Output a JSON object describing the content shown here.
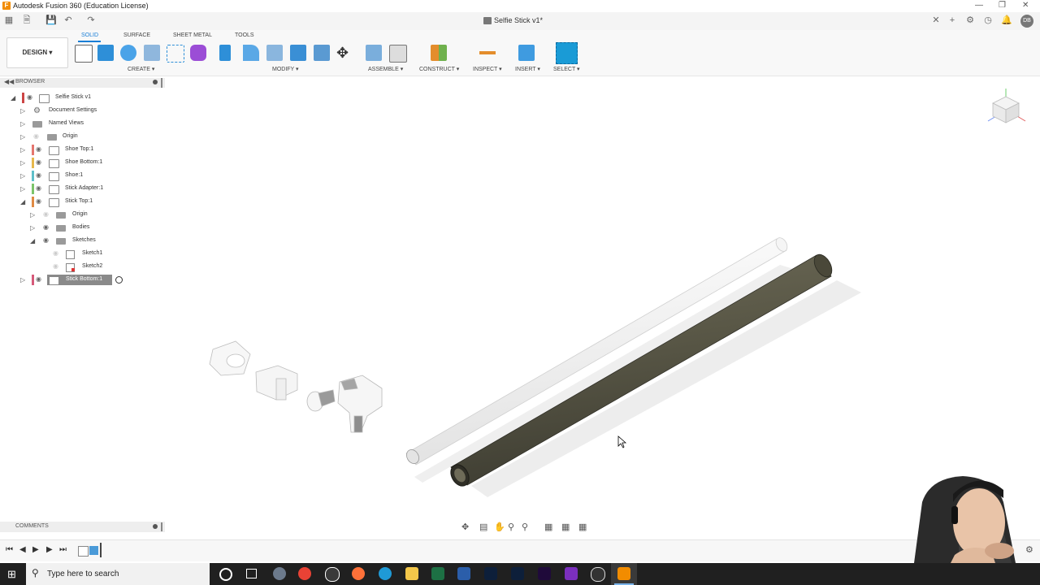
{
  "app": {
    "window_title": "Autodesk Fusion 360 (Education License)",
    "document_tab": "Selfie Stick v1*",
    "user_initials": "DB"
  },
  "toolbar": {
    "workspace": "DESIGN",
    "tabs": [
      "SOLID",
      "SURFACE",
      "SHEET METAL",
      "TOOLS"
    ],
    "groups": {
      "create": "CREATE",
      "modify": "MODIFY",
      "assemble": "ASSEMBLE",
      "construct": "CONSTRUCT",
      "inspect": "INSPECT",
      "insert": "INSERT",
      "select": "SELECT"
    }
  },
  "browser": {
    "title": "BROWSER",
    "items": [
      {
        "label": "Selfie Stick v1"
      },
      {
        "label": "Document Settings"
      },
      {
        "label": "Named Views"
      },
      {
        "label": "Origin"
      },
      {
        "label": "Shoe Top:1"
      },
      {
        "label": "Shoe Bottom:1"
      },
      {
        "label": "Shoe:1"
      },
      {
        "label": "Stick Adapter:1"
      },
      {
        "label": "Stick Top:1"
      },
      {
        "label": "Origin"
      },
      {
        "label": "Bodies"
      },
      {
        "label": "Sketches"
      },
      {
        "label": "Sketch1"
      },
      {
        "label": "Sketch2"
      },
      {
        "label": "Stick Bottom:1"
      }
    ]
  },
  "comments": {
    "title": "COMMENTS"
  },
  "taskbar": {
    "search_placeholder": "Type here to search"
  },
  "colors": {
    "accent": "#1a7fd6",
    "stick_bottom": "#5d5b4a",
    "stick_top": "#f3f3f3"
  }
}
